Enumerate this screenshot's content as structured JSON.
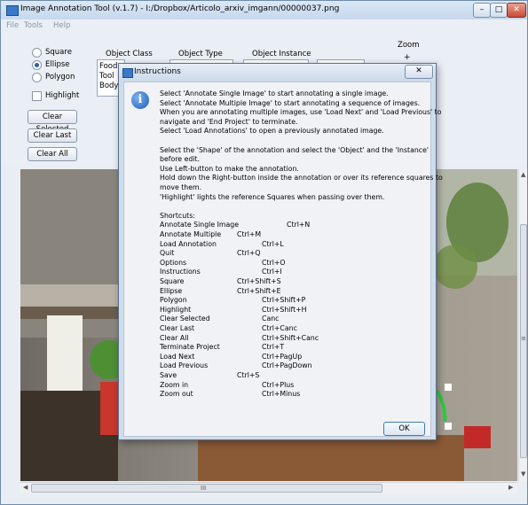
{
  "window": {
    "title": "Image Annotation Tool (v.1.7) - I:/Dropbox/Articolo_arxiv_imgann/00000037.png",
    "controls": {
      "minimize": "–",
      "maximize": "□",
      "close": "✕"
    }
  },
  "menu": [
    "File",
    "Tools",
    "Help"
  ],
  "shapes": [
    {
      "label": "Square",
      "selected": false
    },
    {
      "label": "Ellipse",
      "selected": true
    },
    {
      "label": "Polygon",
      "selected": false
    }
  ],
  "highlight": {
    "label": "Highlight",
    "checked": false
  },
  "buttons": {
    "clear_selected": "Clear Selected",
    "clear_last": "Clear Last",
    "clear_all": "Clear All"
  },
  "columns": {
    "object_class": "Object Class",
    "object_type": "Object Type",
    "object_instance": "Object Instance"
  },
  "object_class_items": [
    "Food",
    "Tool",
    "Body"
  ],
  "zoom": {
    "label": "Zoom",
    "plus": "+"
  },
  "dialog": {
    "title": "Instructions",
    "close": "✕",
    "ok": "OK",
    "paragraph1": [
      "Select 'Annotate Single Image' to start annotating a single image.",
      "Select 'Annotate Multiple Image' to start annotating a sequence of images.",
      "When you are annotating multiple images, use 'Load Next' and 'Load Previous' to",
      "navigate and 'End Project' to terminate.",
      "Select 'Load Annotations' to open a previously annotated image."
    ],
    "paragraph2": [
      "Select the 'Shape' of the annotation and select the 'Object' and the 'Instance'",
      "before edit.",
      "Use Left-button to make the annotation.",
      "Hold down the Right-button inside the annotation or over its reference squares to",
      "move them.",
      "'Highlight' lights the reference Squares when passing over them."
    ],
    "shortcuts_title": "Shortcuts:",
    "shortcuts": [
      {
        "name": "Annotate Single Image",
        "key": "Ctrl+N"
      },
      {
        "name": "Annotate Multiple",
        "key": "Ctrl+M"
      },
      {
        "name": "Load Annotation",
        "key": "Ctrl+L"
      },
      {
        "name": "Quit",
        "key": "Ctrl+Q"
      },
      {
        "name": "Options",
        "key": "Ctrl+O"
      },
      {
        "name": "Instructions",
        "key": "Ctrl+I"
      },
      {
        "name": "Square",
        "key": "Ctrl+Shift+S"
      },
      {
        "name": "Ellipse",
        "key": "Ctrl+Shift+E"
      },
      {
        "name": "Polygon",
        "key": "Ctrl+Shift+P"
      },
      {
        "name": "Highlight",
        "key": "Ctrl+Shift+H"
      },
      {
        "name": "Clear Selected",
        "key": "Canc"
      },
      {
        "name": "Clear Last",
        "key": "Ctrl+Canc"
      },
      {
        "name": "Clear All",
        "key": "Ctrl+Shift+Canc"
      },
      {
        "name": "Terminate Project",
        "key": "Ctrl+T"
      },
      {
        "name": "Load Next",
        "key": "Ctrl+PagUp"
      },
      {
        "name": "Load Previous",
        "key": "Ctrl+PagDown"
      },
      {
        "name": "Save",
        "key": "Ctrl+S"
      },
      {
        "name": "Zoom in",
        "key": "Ctrl+Plus"
      },
      {
        "name": "Zoom out",
        "key": "Ctrl+Minus"
      }
    ]
  },
  "scrollbar": {
    "h_thumb_grip": "III",
    "v_thumb_grip": "≡"
  },
  "colors": {
    "annotation": "#2ecc40",
    "accent": "#2a5ea8"
  }
}
